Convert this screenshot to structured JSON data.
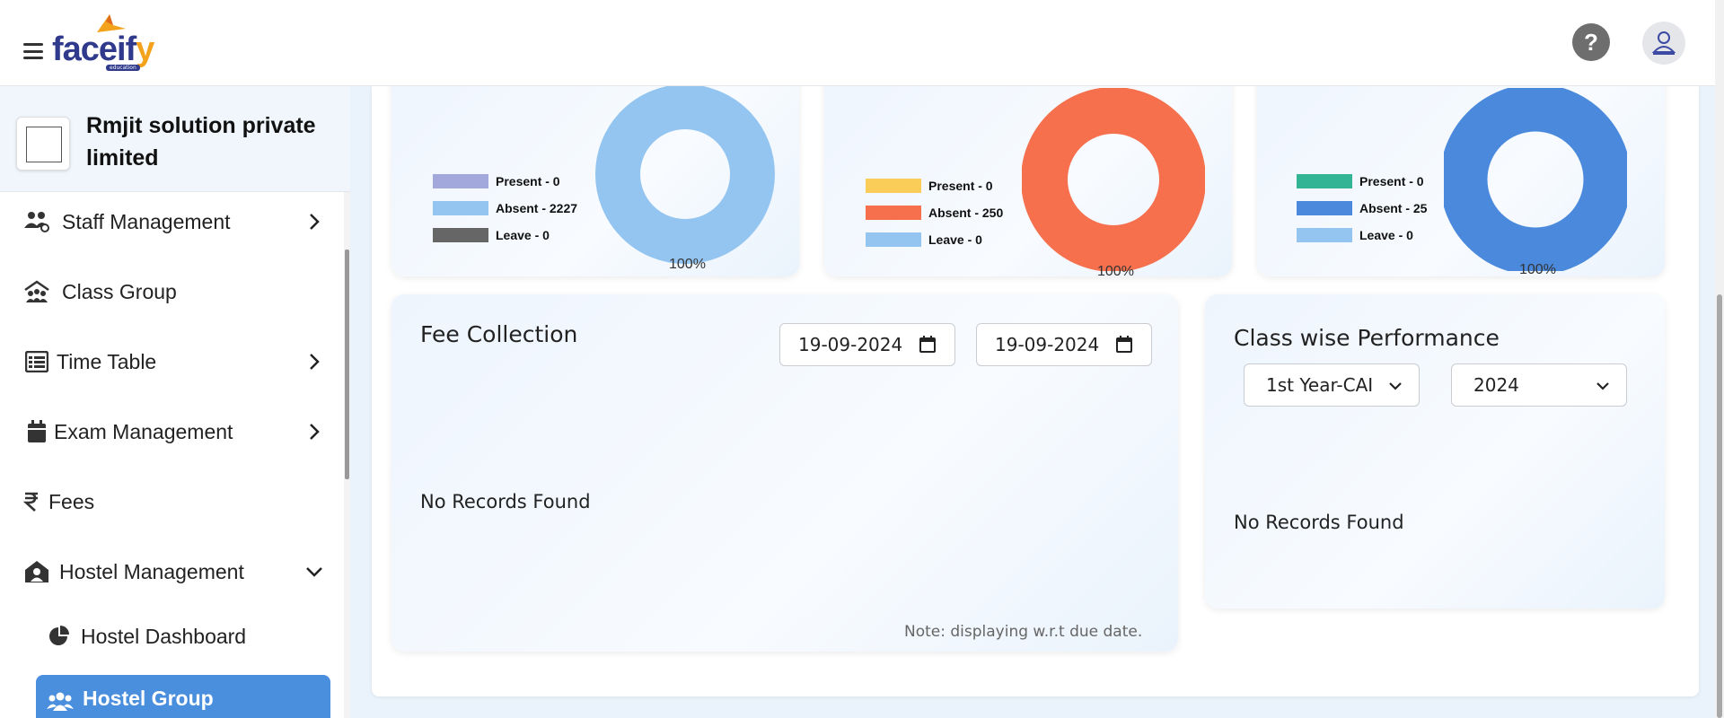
{
  "header": {
    "logo_text_main": "faceif",
    "logo_text_accent": "y",
    "logo_subtitle": "education",
    "help_label": "?"
  },
  "sidebar": {
    "org_name": "Rmjit solution private limited",
    "items": [
      {
        "label": "Staff Management",
        "icon": "staff-icon",
        "has_chevron": true
      },
      {
        "label": "Class Group",
        "icon": "class-group-icon",
        "has_chevron": false
      },
      {
        "label": "Time Table",
        "icon": "timetable-icon",
        "has_chevron": true
      },
      {
        "label": "Exam Management",
        "icon": "calendar-icon",
        "has_chevron": true
      },
      {
        "label": "Fees",
        "icon": "rupee-icon",
        "has_chevron": false
      },
      {
        "label": "Hostel Management",
        "icon": "hostel-icon",
        "has_chevron": true,
        "expanded": true
      },
      {
        "label": "Hostel Dashboard",
        "icon": "pie-chart-icon",
        "has_chevron": false
      },
      {
        "label": "Hostel Group",
        "icon": "users-icon",
        "has_chevron": false,
        "active": true
      }
    ]
  },
  "attendance_cards": [
    {
      "legend": [
        {
          "label": "Present - 0",
          "color": "#a3a8dc"
        },
        {
          "label": "Absent - 2227",
          "color": "#93c5f0"
        },
        {
          "label": "Leave - 0",
          "color": "#666666"
        }
      ],
      "donut_color": "#93c5f0",
      "percent_label": "100%"
    },
    {
      "legend": [
        {
          "label": "Present - 0",
          "color": "#f9cd58"
        },
        {
          "label": "Absent - 250",
          "color": "#f6704d"
        },
        {
          "label": "Leave - 0",
          "color": "#93c5f0"
        }
      ],
      "donut_color": "#f6704d",
      "percent_label": "100%"
    },
    {
      "legend": [
        {
          "label": "Present - 0",
          "color": "#33b495"
        },
        {
          "label": "Absent - 25",
          "color": "#4a89dc"
        },
        {
          "label": "Leave - 0",
          "color": "#93c5f0"
        }
      ],
      "donut_color": "#4a89dc",
      "percent_label": "100%"
    }
  ],
  "fee_collection": {
    "title": "Fee Collection",
    "from_date": "19-09-2024",
    "to_date": "19-09-2024",
    "empty_text": "No Records Found",
    "note": "Note: displaying w.r.t due date."
  },
  "class_performance": {
    "title": "Class wise Performance",
    "class_select": "1st Year-CAI",
    "year_select": "2024",
    "empty_text": "No Records Found"
  }
}
